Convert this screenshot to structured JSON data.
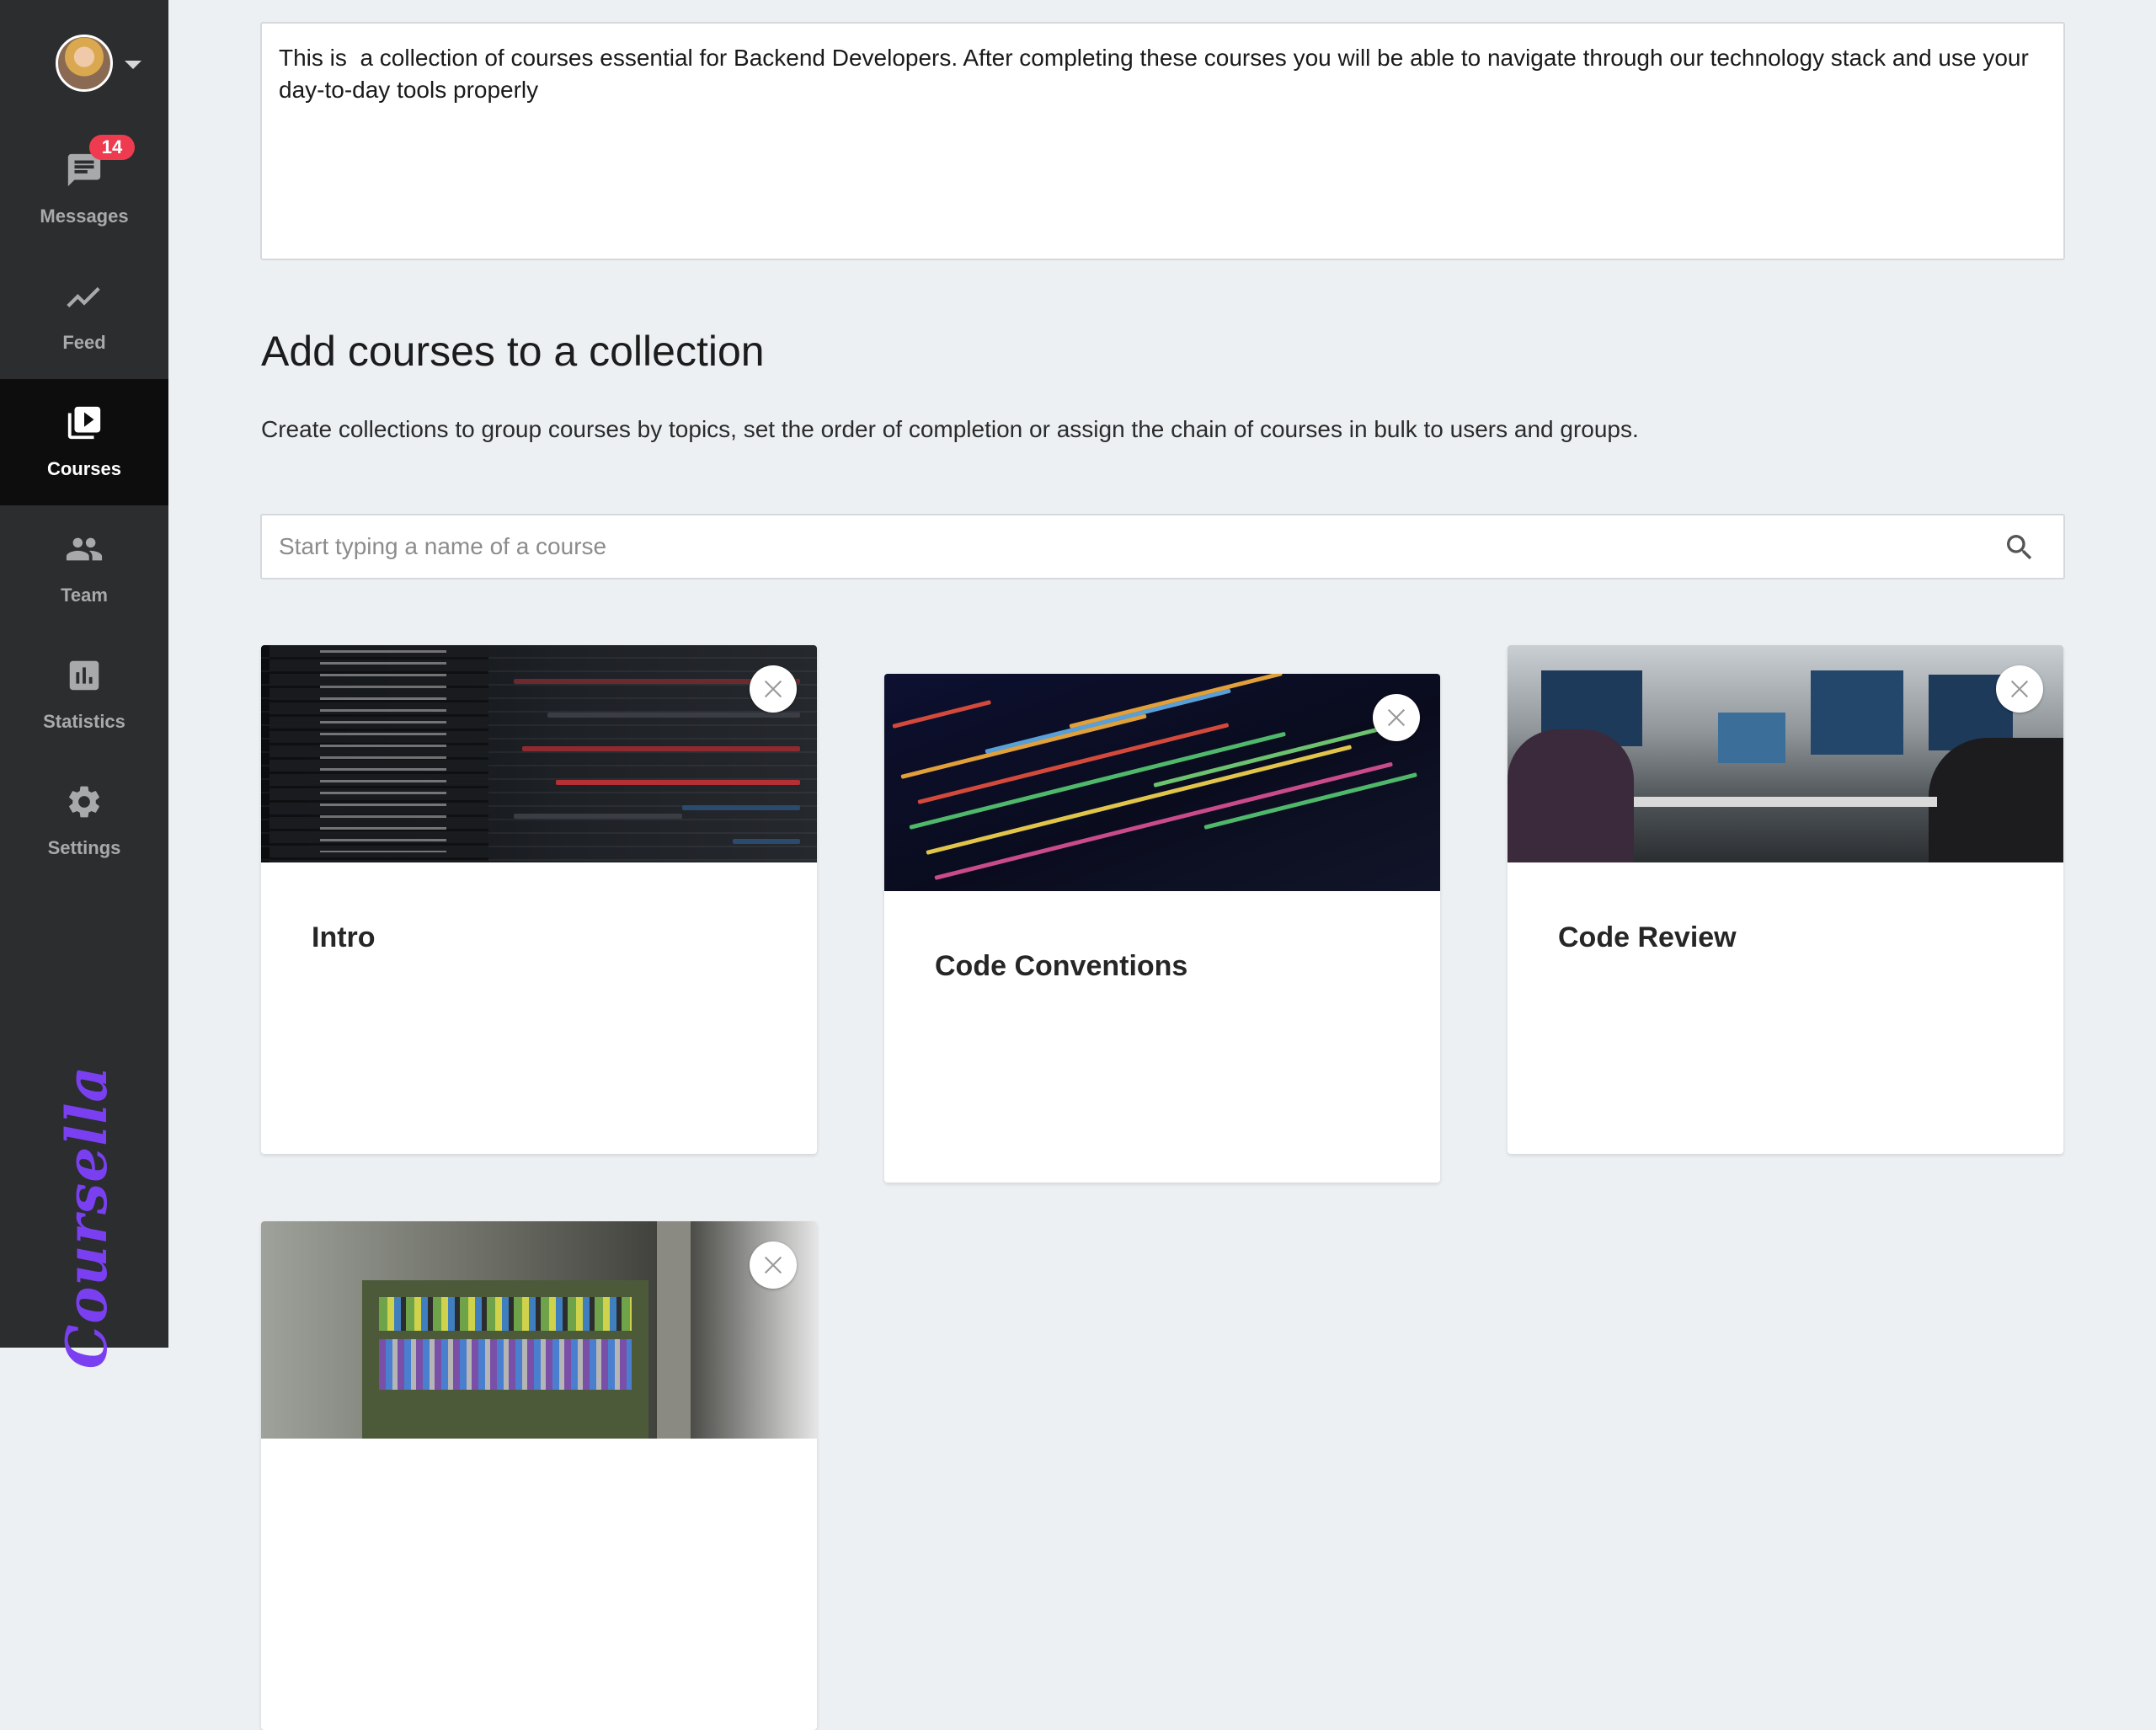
{
  "sidebar": {
    "user": {
      "avatar_alt": "User avatar"
    },
    "nav": [
      {
        "key": "messages",
        "label": "Messages",
        "badge": "14",
        "icon": "messages-icon",
        "active": false
      },
      {
        "key": "feed",
        "label": "Feed",
        "icon": "feed-trend-icon",
        "active": false
      },
      {
        "key": "courses",
        "label": "Courses",
        "icon": "courses-play-icon",
        "active": true
      },
      {
        "key": "team",
        "label": "Team",
        "icon": "team-people-icon",
        "active": false
      },
      {
        "key": "statistics",
        "label": "Statistics",
        "icon": "statistics-bar-icon",
        "active": false
      },
      {
        "key": "settings",
        "label": "Settings",
        "icon": "settings-gear-icon",
        "active": false
      }
    ],
    "brand": "Coursella"
  },
  "collection": {
    "description": "This is  a collection of courses essential for Backend Developers. After completing these courses you will be able to navigate through our technology stack and use your day-to-day tools properly"
  },
  "add_courses": {
    "heading": "Add courses to a collection",
    "description": "Create collections to group courses by topics, set the order of completion or assign the chain of courses in bulk to users and groups.",
    "search_placeholder": "Start typing a name of a course"
  },
  "courses": [
    {
      "title": "Intro",
      "image": "video-editor-timeline"
    },
    {
      "title": "Code Conventions",
      "image": "code-on-screen"
    },
    {
      "title": "Code Review",
      "image": "office-developers"
    },
    {
      "title": "",
      "image": "hardware-cables"
    }
  ],
  "colors": {
    "sidebar_bg": "#2b2d2f",
    "sidebar_active_bg": "#0d0d0d",
    "badge": "#ef3b4f",
    "brand": "#7b3ff2",
    "page_bg": "#edf0f3"
  }
}
